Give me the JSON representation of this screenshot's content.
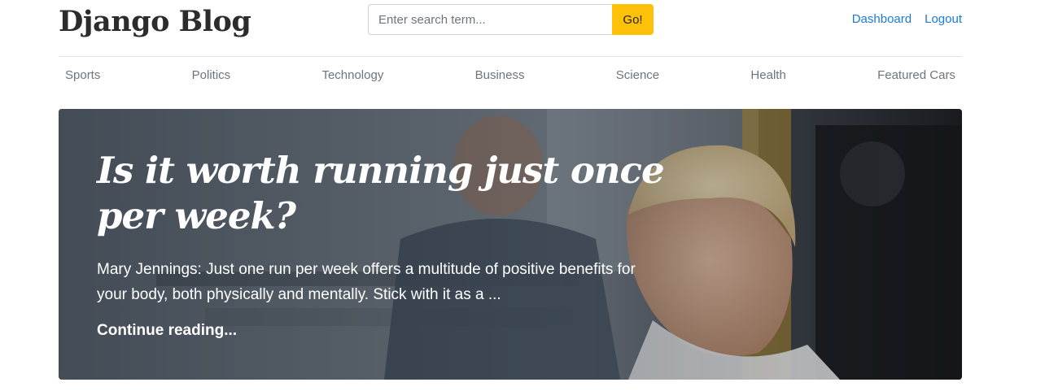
{
  "header": {
    "brand": "Django Blog",
    "search_placeholder": "Enter search term...",
    "search_button": "Go!",
    "links": [
      "Dashboard",
      "Logout"
    ]
  },
  "nav": {
    "items": [
      "Sports",
      "Politics",
      "Technology",
      "Business",
      "Science",
      "Health",
      "Featured Cars"
    ]
  },
  "hero": {
    "title": "Is it worth running just once per week?",
    "excerpt": "Mary Jennings: Just one run per week offers a multitude of positive benefits for your body, both physically and mentally. Stick with it as a ...",
    "link_text": "Continue reading..."
  },
  "colors": {
    "accent_button": "#ffc107",
    "link": "#1a7ad6",
    "nav_text": "#6c757d"
  }
}
